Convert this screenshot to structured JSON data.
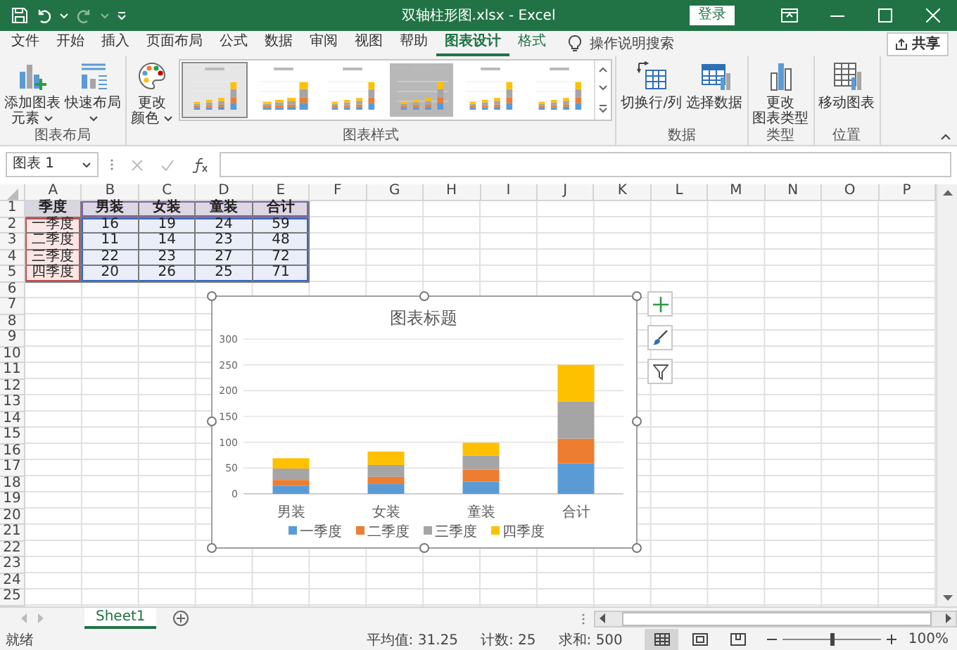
{
  "title_bar": {
    "title": "双轴柱形图.xlsx  -  Excel",
    "sign_in": "登录"
  },
  "menu_tabs": [
    {
      "label": "文件",
      "selected": false,
      "kind": "normal"
    },
    {
      "label": "开始",
      "selected": false,
      "kind": "normal"
    },
    {
      "label": "插入",
      "selected": false,
      "kind": "normal"
    },
    {
      "label": "页面布局",
      "selected": false,
      "kind": "normal"
    },
    {
      "label": "公式",
      "selected": false,
      "kind": "normal"
    },
    {
      "label": "数据",
      "selected": false,
      "kind": "normal"
    },
    {
      "label": "审阅",
      "selected": false,
      "kind": "normal"
    },
    {
      "label": "视图",
      "selected": false,
      "kind": "normal"
    },
    {
      "label": "帮助",
      "selected": false,
      "kind": "normal"
    },
    {
      "label": "图表设计",
      "selected": true,
      "kind": "contextual"
    },
    {
      "label": "格式",
      "selected": false,
      "kind": "contextual"
    }
  ],
  "tell_me": "操作说明搜索",
  "share": "共享",
  "ribbon_groups": [
    {
      "label": "图表布局",
      "items": [
        {
          "kind": "button",
          "lines": [
            "添加图表",
            "元素"
          ],
          "dropdown": true
        },
        {
          "kind": "button",
          "lines": [
            "快速布局"
          ],
          "dropdown": true
        }
      ]
    },
    {
      "label": "图表样式",
      "items": [
        {
          "kind": "button",
          "lines": [
            "更改",
            "颜色"
          ],
          "dropdown": true
        },
        {
          "kind": "gallery",
          "styles": [
            {
              "selected": true
            },
            {
              "selected": false
            },
            {
              "selected": false
            },
            {
              "selected": false
            },
            {
              "selected": false
            },
            {
              "selected": false
            }
          ]
        }
      ]
    },
    {
      "label": "数据",
      "items": [
        {
          "kind": "button",
          "lines": [
            "切换行/列"
          ],
          "dropdown": false
        },
        {
          "kind": "button",
          "lines": [
            "选择数据"
          ],
          "dropdown": false
        }
      ]
    },
    {
      "label": "类型",
      "items": [
        {
          "kind": "button",
          "lines": [
            "更改",
            "图表类型"
          ],
          "dropdown": false
        }
      ]
    },
    {
      "label": "位置",
      "items": [
        {
          "kind": "button",
          "lines": [
            "移动图表"
          ],
          "dropdown": false
        }
      ]
    }
  ],
  "formula_bar": {
    "name_box": "图表 1"
  },
  "sheet": {
    "columns": [
      "A",
      "B",
      "C",
      "D",
      "E",
      "F",
      "G",
      "H",
      "I",
      "J",
      "K",
      "L",
      "M",
      "N",
      "O",
      "P"
    ],
    "rows": [
      "1",
      "2",
      "3",
      "4",
      "5",
      "6",
      "7",
      "8",
      "9",
      "10",
      "11",
      "12",
      "13",
      "14",
      "15",
      "16",
      "17",
      "18",
      "19",
      "20",
      "21",
      "22",
      "23",
      "24",
      "25"
    ],
    "cells": [
      [
        "季度",
        "男装",
        "女装",
        "童装",
        "合计"
      ],
      [
        "一季度",
        "16",
        "19",
        "24",
        "59"
      ],
      [
        "二季度",
        "11",
        "14",
        "23",
        "48"
      ],
      [
        "三季度",
        "22",
        "23",
        "27",
        "72"
      ],
      [
        "四季度",
        "20",
        "26",
        "25",
        "71"
      ]
    ]
  },
  "chart": {
    "chart_data": {
      "type": "bar",
      "title": "图表标题",
      "stacked": true,
      "categories": [
        "男装",
        "女装",
        "童装",
        "合计"
      ],
      "series": [
        {
          "name": "一季度",
          "color": "#5b9bd5",
          "values": [
            16,
            19,
            24,
            59
          ]
        },
        {
          "name": "二季度",
          "color": "#ed7d31",
          "values": [
            11,
            14,
            23,
            48
          ]
        },
        {
          "name": "三季度",
          "color": "#a5a5a5",
          "values": [
            22,
            23,
            27,
            72
          ]
        },
        {
          "name": "四季度",
          "color": "#ffc000",
          "values": [
            20,
            26,
            25,
            71
          ]
        }
      ],
      "grid": true,
      "legend": "bottom",
      "ylim": [
        0,
        300
      ],
      "yticks": [
        0,
        50,
        100,
        150,
        200,
        250,
        300
      ]
    }
  },
  "sheet_tabs": [
    {
      "label": "Sheet1",
      "selected": true
    }
  ],
  "status_bar": {
    "status": "就绪",
    "stats": [
      "平均值: 31.25",
      "计数: 25",
      "求和: 500"
    ],
    "view_buttons": [
      {
        "selected": true
      },
      {
        "selected": false
      },
      {
        "selected": false
      }
    ],
    "zoom": {
      "label": "100%",
      "level": 0.5
    }
  }
}
